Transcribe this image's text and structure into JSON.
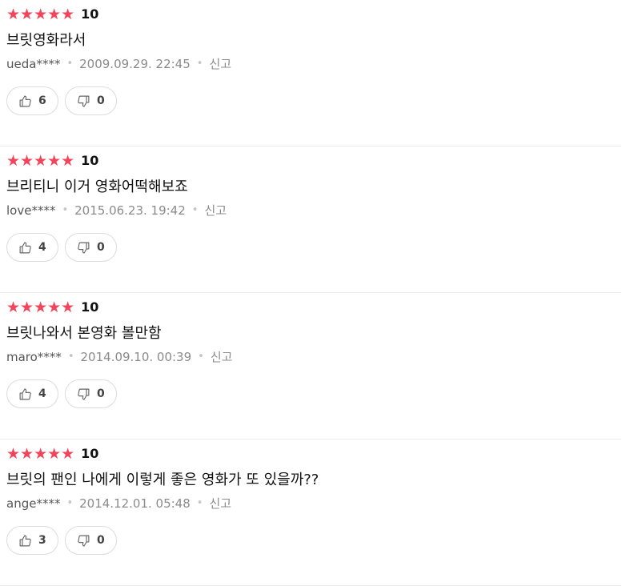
{
  "reviews": [
    {
      "stars": "★★★★★",
      "score": "10",
      "comment": "브릿영화라서",
      "user": "ueda****",
      "date": "2009.09.29. 22:45",
      "report": "신고",
      "likes": "6",
      "dislikes": "0"
    },
    {
      "stars": "★★★★★",
      "score": "10",
      "comment": "브리티니 이거 영화어떡해보죠",
      "user": "love****",
      "date": "2015.06.23. 19:42",
      "report": "신고",
      "likes": "4",
      "dislikes": "0"
    },
    {
      "stars": "★★★★★",
      "score": "10",
      "comment": "브릿나와서 본영화 볼만함",
      "user": "maro****",
      "date": "2014.09.10. 00:39",
      "report": "신고",
      "likes": "4",
      "dislikes": "0"
    },
    {
      "stars": "★★★★★",
      "score": "10",
      "comment": "브릿의 팬인 나에게 이렇게 좋은 영화가 또 있을까??",
      "user": "ange****",
      "date": "2014.12.01. 05:48",
      "report": "신고",
      "likes": "3",
      "dislikes": "0"
    }
  ],
  "colors": {
    "star": "#f2445a",
    "meta": "#8b8b8b",
    "border": "#dcdcdc"
  },
  "icons": {
    "like": "thumbs-up-icon",
    "dislike": "thumbs-down-icon"
  }
}
